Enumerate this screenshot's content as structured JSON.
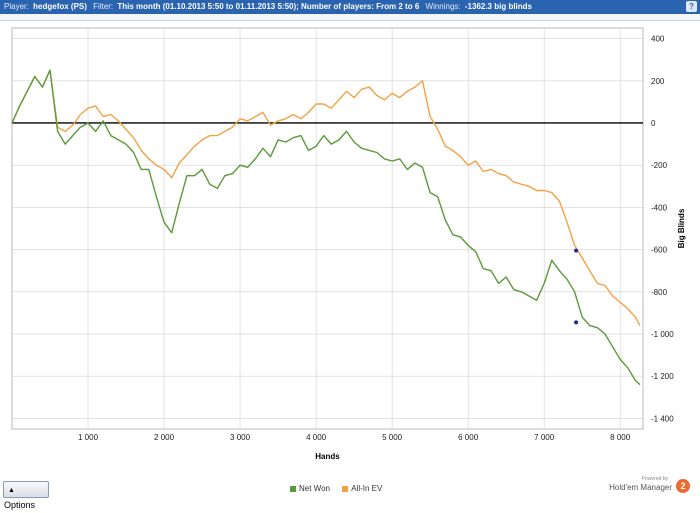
{
  "header": {
    "player_label": "Player:",
    "player_value": "hedgefox (PS)",
    "filter_label": "Filter:",
    "filter_value": "This month (01.10.2013 5:50 to 01.11.2013 5:50); Number of players: From 2 to 6",
    "winnings_label": "Winnings:",
    "winnings_value": "-1362.3 big blinds",
    "help_label": "?"
  },
  "footer": {
    "options_label": "Options",
    "powered_by": "Powered by",
    "brand_name": "Hold'em Manager",
    "brand_badge": "2"
  },
  "colors": {
    "net_won": "#5a9a3a",
    "all_in_ev": "#f4a144",
    "zero_line": "#000000",
    "grid": "#d0d0d0",
    "header_bg": "#2a64b0"
  },
  "chart_data": {
    "type": "line",
    "title": "",
    "xlabel": "Hands",
    "ylabel": "Big Blinds",
    "xlim": [
      0,
      8300
    ],
    "ylim": [
      -1450,
      450
    ],
    "x_ticks": [
      1000,
      2000,
      3000,
      4000,
      5000,
      6000,
      7000,
      8000
    ],
    "x_tick_labels": [
      "1 000",
      "2 000",
      "3 000",
      "4 000",
      "5 000",
      "6 000",
      "7 000",
      "8 000"
    ],
    "y_ticks": [
      400,
      200,
      0,
      -200,
      -400,
      -600,
      -800,
      -1000,
      -1200,
      -1400
    ],
    "y_tick_labels": [
      "400",
      "200",
      "0",
      "-200",
      "-400",
      "-600",
      "-800",
      "-1 000",
      "-1 200",
      "-1 400"
    ],
    "grid": true,
    "legend_position": "bottom",
    "series": [
      {
        "name": "Net Won",
        "color": "#5a9a3a",
        "x": [
          0,
          100,
          200,
          300,
          400,
          500,
          600,
          700,
          800,
          900,
          1000,
          1100,
          1200,
          1300,
          1400,
          1500,
          1600,
          1700,
          1800,
          1900,
          2000,
          2100,
          2200,
          2300,
          2400,
          2500,
          2600,
          2700,
          2800,
          2900,
          3000,
          3100,
          3200,
          3300,
          3400,
          3500,
          3600,
          3700,
          3800,
          3900,
          4000,
          4100,
          4200,
          4300,
          4400,
          4500,
          4600,
          4700,
          4800,
          4900,
          5000,
          5100,
          5200,
          5300,
          5400,
          5500,
          5600,
          5700,
          5800,
          5900,
          6000,
          6100,
          6200,
          6300,
          6400,
          6500,
          6600,
          6700,
          6800,
          6900,
          7000,
          7100,
          7200,
          7300,
          7400,
          7500,
          7600,
          7700,
          7800,
          7900,
          8000,
          8100,
          8200,
          8260
        ],
        "values": [
          0,
          80,
          150,
          220,
          170,
          250,
          -40,
          -100,
          -60,
          -20,
          0,
          -40,
          10,
          -60,
          -80,
          -100,
          -140,
          -220,
          -220,
          -350,
          -470,
          -520,
          -380,
          -250,
          -250,
          -220,
          -290,
          -310,
          -250,
          -240,
          -200,
          -210,
          -170,
          -120,
          -160,
          -80,
          -90,
          -70,
          -60,
          -130,
          -110,
          -60,
          -100,
          -80,
          -40,
          -90,
          -120,
          -130,
          -140,
          -170,
          -180,
          -170,
          -220,
          -190,
          -210,
          -330,
          -350,
          -460,
          -530,
          -540,
          -580,
          -610,
          -690,
          -700,
          -760,
          -730,
          -790,
          -800,
          -820,
          -840,
          -760,
          -650,
          -700,
          -740,
          -800,
          -920,
          -960,
          -970,
          -1000,
          -1060,
          -1120,
          -1160,
          -1220,
          -1240
        ]
      },
      {
        "name": "All-In EV",
        "color": "#f4a144",
        "x": [
          0,
          100,
          200,
          300,
          400,
          500,
          600,
          700,
          800,
          900,
          1000,
          1100,
          1200,
          1300,
          1400,
          1500,
          1600,
          1700,
          1800,
          1900,
          2000,
          2100,
          2200,
          2300,
          2400,
          2500,
          2600,
          2700,
          2800,
          2900,
          3000,
          3100,
          3200,
          3300,
          3400,
          3500,
          3600,
          3700,
          3800,
          3900,
          4000,
          4100,
          4200,
          4300,
          4400,
          4500,
          4600,
          4700,
          4800,
          4900,
          5000,
          5100,
          5200,
          5300,
          5400,
          5500,
          5600,
          5700,
          5800,
          5900,
          6000,
          6100,
          6200,
          6300,
          6400,
          6500,
          6600,
          6700,
          6800,
          6900,
          7000,
          7100,
          7200,
          7300,
          7400,
          7500,
          7600,
          7700,
          7800,
          7900,
          8000,
          8100,
          8200,
          8260
        ],
        "values": [
          0,
          80,
          150,
          220,
          170,
          250,
          -20,
          -40,
          -10,
          40,
          70,
          80,
          30,
          40,
          10,
          -30,
          -70,
          -130,
          -170,
          -200,
          -220,
          -260,
          -190,
          -150,
          -110,
          -80,
          -60,
          -60,
          -40,
          -20,
          20,
          10,
          30,
          50,
          -10,
          10,
          20,
          40,
          20,
          50,
          90,
          90,
          70,
          110,
          150,
          120,
          160,
          170,
          130,
          110,
          140,
          120,
          150,
          170,
          200,
          30,
          -30,
          -110,
          -130,
          -160,
          -200,
          -180,
          -230,
          -220,
          -240,
          -250,
          -280,
          -290,
          -300,
          -320,
          -320,
          -330,
          -370,
          -470,
          -580,
          -640,
          -700,
          -760,
          -770,
          -820,
          -850,
          -880,
          -920,
          -960
        ]
      }
    ],
    "markers": [
      {
        "series": "All-In EV",
        "x": 7420,
        "y": -605,
        "color": "#1a2a9a"
      },
      {
        "series": "Net Won",
        "x": 7420,
        "y": -945,
        "color": "#1a2a9a"
      }
    ]
  }
}
